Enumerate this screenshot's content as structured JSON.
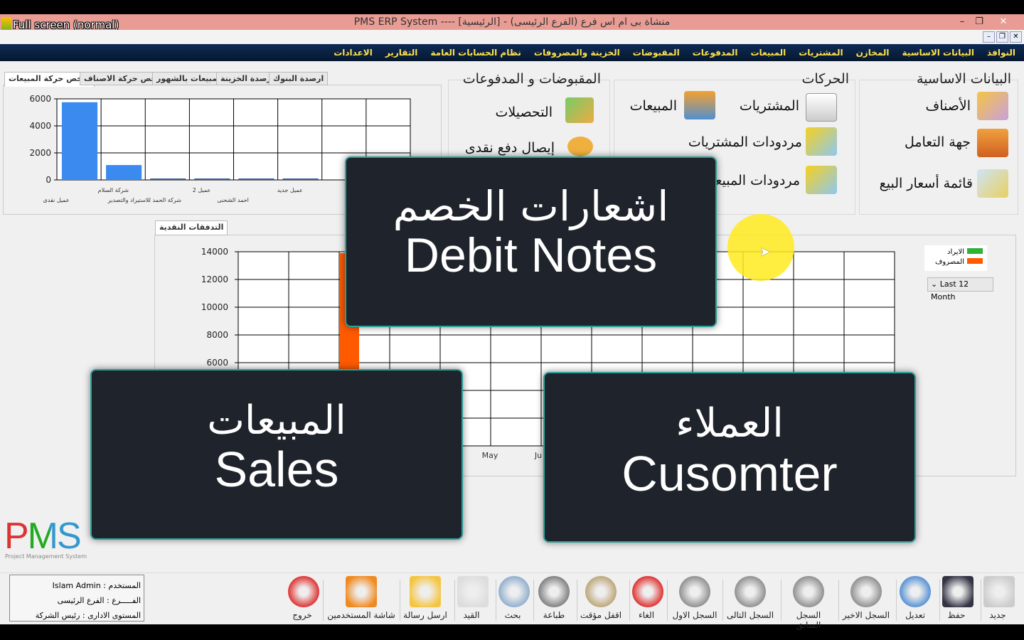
{
  "window": {
    "title": "PMS ERP System ---- منشاة بى ام اس فرع (الفرع الرئيسى) - [الرئيسية]",
    "fullscreen_label": "Full screen (normal)"
  },
  "menu": [
    "النوافذ",
    "البيانات الاساسية",
    "المخازن",
    "المشتريات",
    "المبيعات",
    "المدفوعات",
    "المقبوضات",
    "الخزينة والمصروفات",
    "نظام الحسابات العامة",
    "التقارير",
    "الاعدادات"
  ],
  "panels": {
    "basic": {
      "title": "البيانات الاساسية",
      "items": [
        "الأصناف",
        "جهة التعامل",
        "قائمة أسعار البيع"
      ]
    },
    "movements": {
      "title": "الحركات",
      "items": [
        "المشتريات",
        "المبيعات",
        "مردودات المشتريات",
        "مردودات المبيعات"
      ]
    },
    "receipts": {
      "title": "المقبوضات و المدفوعات",
      "items": [
        "التحصيلات",
        "إيصال دفع نقدى"
      ]
    }
  },
  "top_tabs": [
    "ملخص حركة المبيعات",
    "ملخص حركة الاصناف",
    "المبيعات بالشهور",
    "ارصدة الخزينة",
    "ارصدة البنوك"
  ],
  "cash_tab": "التدفقات النقدية",
  "period_select": "Last 12 Month",
  "colors": {
    "income": "#2db336",
    "expense": "#ff5a00",
    "bar": "#3a8af0",
    "overlay_border": "#2aa198"
  },
  "chart_data": [
    {
      "type": "bar",
      "ylim": [
        0,
        6000
      ],
      "yticks": [
        "0",
        "2000",
        "4000",
        "6000"
      ],
      "grid": true,
      "categories": [
        "عميل نقدى",
        "شركة السلام",
        "شركة الحمد للاستيراد والتصدير",
        "عميل 2",
        "احمد الشحنى",
        "عميل جديد",
        "",
        ""
      ],
      "values": [
        5750,
        1100,
        50,
        50,
        50,
        50,
        0,
        0
      ]
    },
    {
      "type": "bar",
      "ylim": [
        0,
        14000
      ],
      "yticks": [
        "6000",
        "8000",
        "10000",
        "12000",
        "14000"
      ],
      "grid": true,
      "legend": [
        "الايراد",
        "المصروف"
      ],
      "legend_placement": "right",
      "visible_xlabels": [
        "May",
        "Ju"
      ],
      "series": [
        {
          "name": "المصروف",
          "values": [
            13900
          ]
        },
        {
          "name": "الايراد",
          "values": []
        }
      ]
    }
  ],
  "overlays": [
    {
      "arabic": "اشعارات الخصم",
      "english": "Debit Notes"
    },
    {
      "arabic": "المبيعات",
      "english": "Sales"
    },
    {
      "arabic": "العملاء",
      "english": "Cusomter"
    }
  ],
  "logo": {
    "text": "PMS",
    "sub": "Project Management System"
  },
  "user_info": [
    "المستخدم : Islam Admin",
    "الفـــــرع : الفرع الرئيسى",
    "المستوى الادارى : رئيس الشركة"
  ],
  "toolbar": [
    {
      "label": "جديد",
      "icon": "new-doc-icon"
    },
    {
      "label": "حفظ",
      "icon": "save-icon"
    },
    {
      "label": "تعديل",
      "icon": "refresh-icon"
    },
    {
      "label": "السجل الاخير",
      "icon": "last-record-icon"
    },
    {
      "label": "السجل السابق",
      "icon": "next-icon"
    },
    {
      "label": "السجل التالى",
      "icon": "prev-icon"
    },
    {
      "label": "السجل الاول",
      "icon": "first-record-icon"
    },
    {
      "label": "الغاء",
      "icon": "trash-icon"
    },
    {
      "label": "اقفل مؤقت",
      "icon": "lock-icon"
    },
    {
      "label": "طباعة",
      "icon": "printer-icon"
    },
    {
      "label": "بحث",
      "icon": "search-icon"
    },
    {
      "label": "القيد",
      "icon": "journal-icon"
    },
    {
      "label": "ارسل رسالة",
      "icon": "mail-icon"
    },
    {
      "label": "شاشة المستخدمين",
      "icon": "users-icon"
    },
    {
      "label": "خروج",
      "icon": "exit-icon"
    }
  ]
}
